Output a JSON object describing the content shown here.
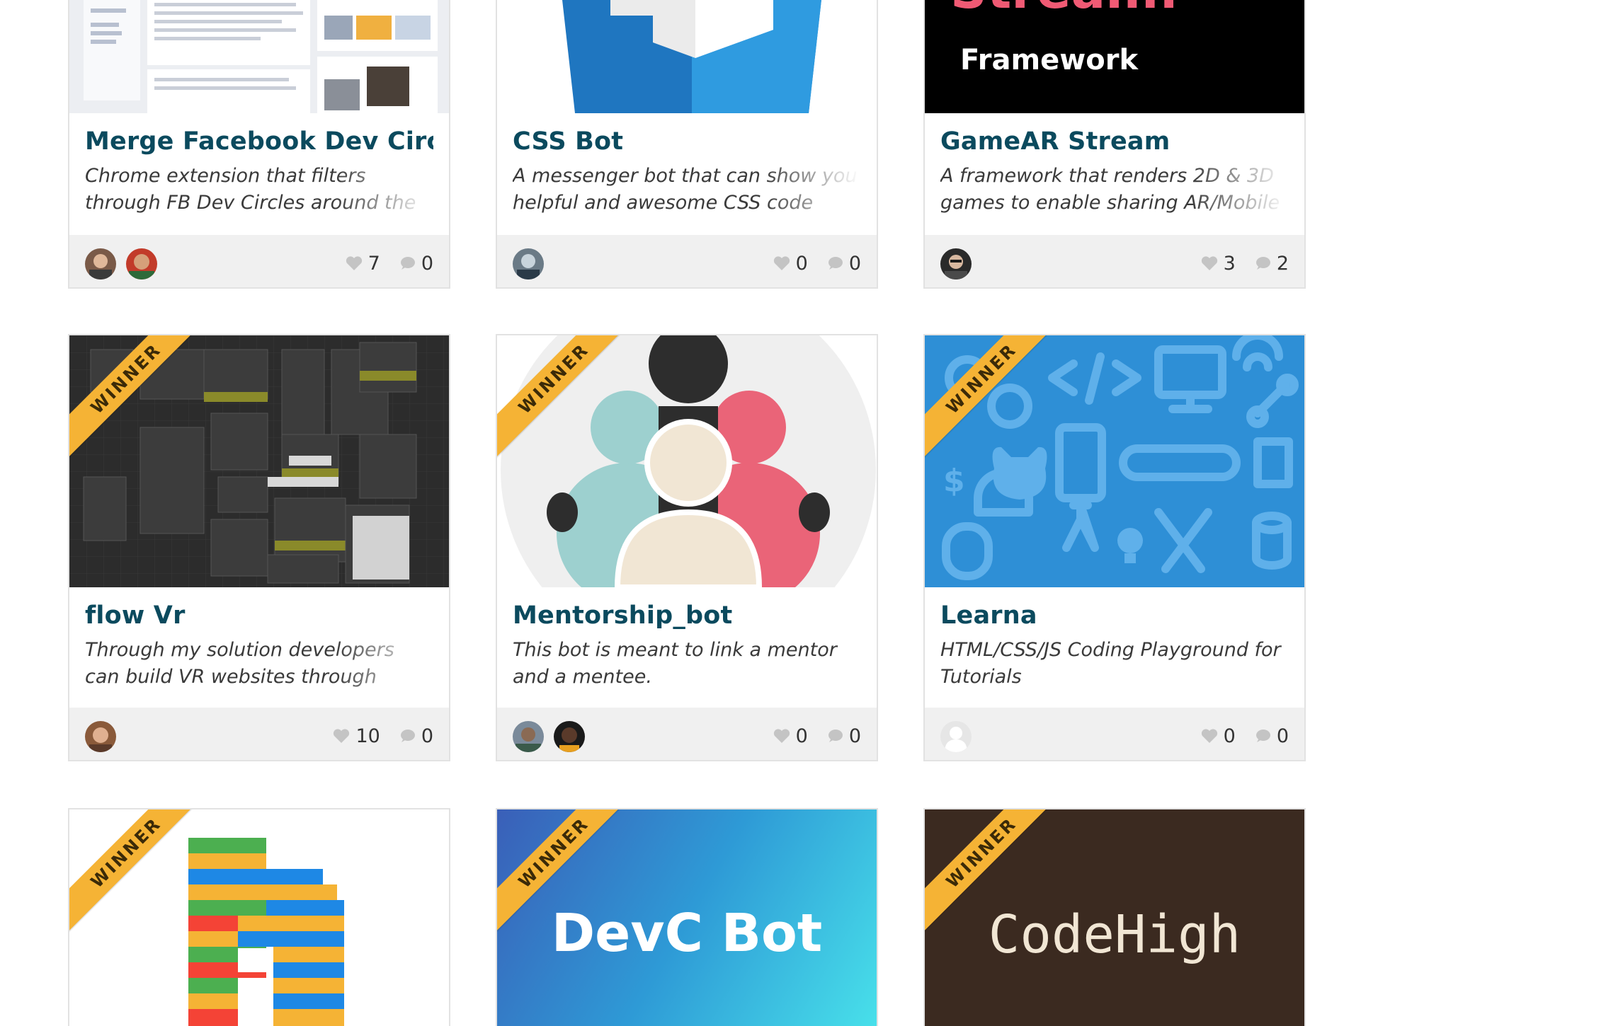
{
  "ribbon_label": "WINNER",
  "cards": [
    {
      "title": "Merge Facebook Dev Circles t",
      "description": "Chrome extension that filters through FB Dev Circles around the world to get",
      "likes": "7",
      "comments": "0"
    },
    {
      "title": "CSS Bot",
      "description": "A messenger bot that can show you helpful and awesome CSS code",
      "likes": "0",
      "comments": "0"
    },
    {
      "title": "GameAR Stream",
      "description": "A framework that renders 2D & 3D games to enable sharing AR/Mobile",
      "likes": "3",
      "comments": "2",
      "image_text": {
        "top": "Stream:",
        "bottom": "Framework"
      }
    },
    {
      "title": "flow Vr",
      "description": "Through my solution developers can build VR websites through Dataflow",
      "likes": "10",
      "comments": "0"
    },
    {
      "title": "Mentorship_bot",
      "description": "This bot is meant to link a mentor and a mentee.",
      "likes": "0",
      "comments": "0"
    },
    {
      "title": "Learna",
      "description": "HTML/CSS/JS Coding Playground for Tutorials",
      "likes": "0",
      "comments": "0"
    },
    {
      "title": "",
      "description": ""
    },
    {
      "title": "",
      "description": "",
      "image_text": "DevC Bot"
    },
    {
      "title": "",
      "description": "",
      "image_text": "CodeHigh"
    }
  ],
  "colors": {
    "title": "#0b4a5e",
    "ribbon": "#f5b335",
    "footer": "#f0f0f0",
    "css_blue": "#2a8fd6",
    "learna_blue": "#2e8fd6",
    "codehigh_bg": "#3b2a20"
  },
  "icons": {
    "like": "heart-icon",
    "comment": "speech-bubble-icon"
  }
}
